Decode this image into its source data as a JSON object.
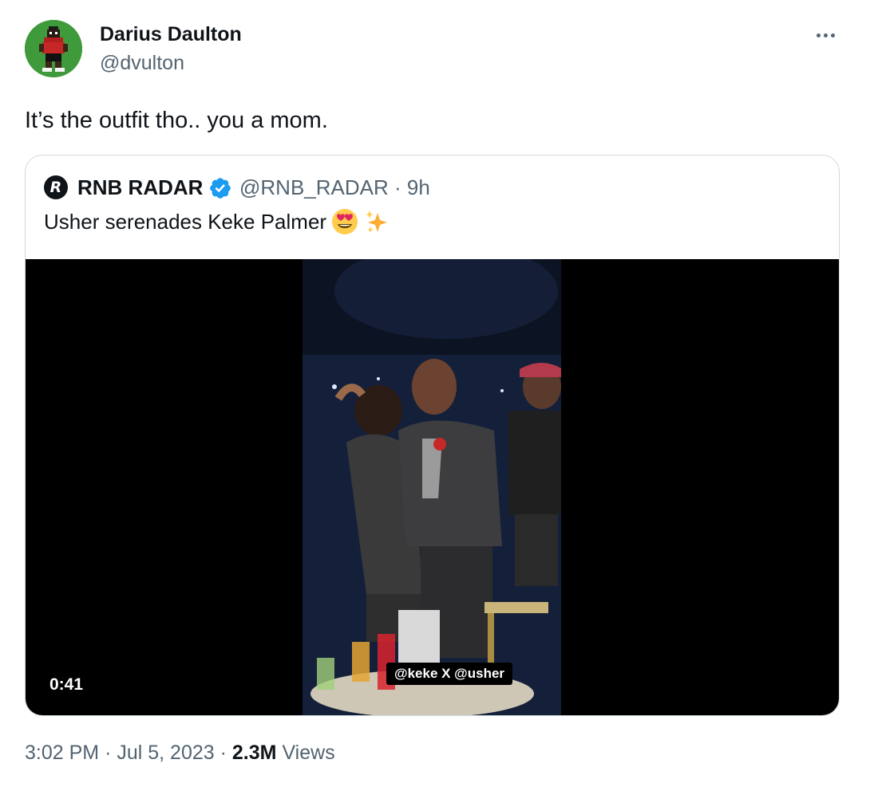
{
  "author": {
    "name": "Darius Daulton",
    "handle": "@dvulton",
    "avatar_icon": "pixel-character-avatar",
    "avatar_bg": "#3f9a3b"
  },
  "more_icon": "more-horizontal-icon",
  "tweet_text": "It’s the outfit tho.. you a mom.",
  "quote": {
    "name": "RNB RADAR",
    "verified_icon": "verified-badge-icon",
    "verified_color": "#1d9bf0",
    "handle_time": "@RNB_RADAR · 9h",
    "text": "Usher serenades Keke Palmer",
    "emojis": [
      "heart-eyes-emoji",
      "sparkles-emoji"
    ],
    "video": {
      "caption": "@keke X @usher",
      "duration": "0:41"
    }
  },
  "meta": {
    "time": "3:02 PM",
    "separator": "·",
    "date": "Jul 5, 2023",
    "views_count": "2.3M",
    "views_label": "Views"
  }
}
